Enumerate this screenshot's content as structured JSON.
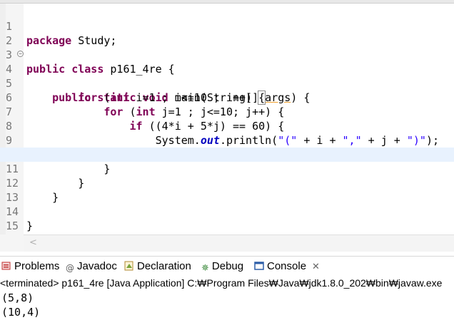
{
  "editor": {
    "line_numbers": [
      "1",
      "2",
      "3",
      "4",
      "5",
      "6",
      "7",
      "8",
      "9",
      "10",
      "11",
      "12",
      "13",
      "14",
      "15"
    ],
    "lines": {
      "l1_kw": "package",
      "l1_rest": " Study;",
      "l3_kw1": "public",
      "l3_kw2": "class",
      "l3_rest": " p161_4re {",
      "l4_kw1": "public",
      "l4_kw2": "static",
      "l4_kw3": "void",
      "l4_a": " main(String[] ",
      "l4_args": "args",
      "l4_b": ") {",
      "l5_kw1": "for",
      "l5_a": " (",
      "l5_kw2": "int",
      "l5_b": " i=1 ; i<=10 ; i++) ",
      "l5_brace": "{",
      "l6_kw1": "for",
      "l6_a": " (",
      "l6_kw2": "int",
      "l6_b": " j=1 ; j<=10; j++) {",
      "l7_kw": "if",
      "l7_rest": " ((4*i + 5*j) == 60) {",
      "l8_a": "System.",
      "l8_out": "out",
      "l8_b": ".println(",
      "l8_s1": "\"(\"",
      "l8_c": " + i + ",
      "l8_s2": "\",\"",
      "l8_d": " + j + ",
      "l8_s3": "\")\"",
      "l8_e": ");",
      "l9": "}",
      "l10": "}",
      "l11": "}",
      "l12": "}",
      "l14": "}"
    }
  },
  "tabs": {
    "problems": "Problems",
    "javadoc": "Javadoc",
    "declaration": "Declaration",
    "debug": "Debug",
    "console": "Console"
  },
  "console": {
    "status": "<terminated> p161_4re [Java Application] C:₩Program Files₩Java₩jdk1.8.0_202₩bin₩javaw.exe",
    "output": [
      "(5,8)",
      "(10,4)"
    ]
  },
  "colors": {
    "keyword": "#7f0055",
    "string": "#2a00ff",
    "field": "#0000c0",
    "current_line": "#e8f2fe"
  }
}
